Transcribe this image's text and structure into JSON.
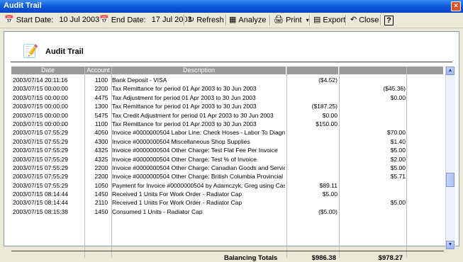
{
  "window": {
    "title": "Audit Trail"
  },
  "toolbar": {
    "start_label": "Start Date:",
    "start_value": "10 Jul 2003",
    "end_label": "End Date:",
    "end_value": "17 Jul 2003",
    "refresh": "Refresh",
    "analyze": "Analyze",
    "print": "Print",
    "export": "Export",
    "close": "Close",
    "help": "?"
  },
  "report": {
    "title": "Audit Trail",
    "columns": [
      "Date",
      "Account",
      "Description",
      "",
      ""
    ],
    "rows": [
      {
        "date": "2003/07/14 20:11:16",
        "account": "1100",
        "description": "Bank Deposit - VISA",
        "v1": "($4.52)",
        "v2": ""
      },
      {
        "date": "2003/07/15 00:00:00",
        "account": "2200",
        "description": "Tax Remittance for period 01 Apr 2003 to 30 Jun 2003",
        "v1": "",
        "v2": "($45.36)"
      },
      {
        "date": "2003/07/15 00:00:00",
        "account": "4475",
        "description": "Tax Adjustment for period 01 Apr 2003 to 30 Jun 2003",
        "v1": "",
        "v2": "$0.00"
      },
      {
        "date": "2003/07/15 00:00:00",
        "account": "1300",
        "description": "Tax Remittance for period 01 Apr 2003 to 30 Jun 2003",
        "v1": "($187.25)",
        "v2": ""
      },
      {
        "date": "2003/07/15 00:00:00",
        "account": "5475",
        "description": "Tax Credit Adjustment for period 01 Apr 2003 to 30 Jun 2003",
        "v1": "$0.00",
        "v2": ""
      },
      {
        "date": "2003/07/15 00:00:00",
        "account": "1100",
        "description": "Tax Remittance for period 01 Apr 2003 to 30 Jun 2003",
        "v1": "$150.00",
        "v2": ""
      },
      {
        "date": "2003/07/15 07:55:29",
        "account": "4050",
        "description": "Invoice #0000000504 Labor Line: Check Hoses - Labor To Diagnos",
        "v1": "",
        "v2": "$70.00"
      },
      {
        "date": "2003/07/15 07:55:29",
        "account": "4300",
        "description": "Invoice #0000000504 Miscellaneous Shop Supplies",
        "v1": "",
        "v2": "$1.40"
      },
      {
        "date": "2003/07/15 07:55:29",
        "account": "4325",
        "description": "Invoice #0000000504 Other Charge: Test Flat Fee Per Invoice",
        "v1": "",
        "v2": "$5.00"
      },
      {
        "date": "2003/07/15 07:55:29",
        "account": "4325",
        "description": "Invoice #0000000504 Other Charge: Test % of Invoice",
        "v1": "",
        "v2": "$2.00"
      },
      {
        "date": "2003/07/15 07:55:29",
        "account": "2200",
        "description": "Invoice #0000000504 Other Charge: Canadian Goods and Services",
        "v1": "",
        "v2": "$5.00"
      },
      {
        "date": "2003/07/15 07:55:29",
        "account": "2200",
        "description": "Invoice #0000000504 Other Charge: British Columbia Provincial Sal",
        "v1": "",
        "v2": "$5.71"
      },
      {
        "date": "2003/07/15 07:55:29",
        "account": "1050",
        "description": "Payment for Invoice #0000000504 by Adamczyk, Greg using Cash",
        "v1": "$89.11",
        "v2": ""
      },
      {
        "date": "2003/07/15 08:14:44",
        "account": "1450",
        "description": "Received 1 Units For Work Order  - Radiator Cap",
        "v1": "$5.00",
        "v2": ""
      },
      {
        "date": "2003/07/15 08:14:44",
        "account": "2110",
        "description": "Received 1 Units For Work Order  - Radiator Cap",
        "v1": "",
        "v2": "$5.00"
      },
      {
        "date": "2003/07/15 08:15:38",
        "account": "1450",
        "description": "Consumed 1 Units  - Radiator Cap",
        "v1": "($5.00)",
        "v2": ""
      }
    ],
    "totals": {
      "label": "Balancing Totals",
      "v1": "$986.38",
      "v2": "$978.27"
    }
  }
}
